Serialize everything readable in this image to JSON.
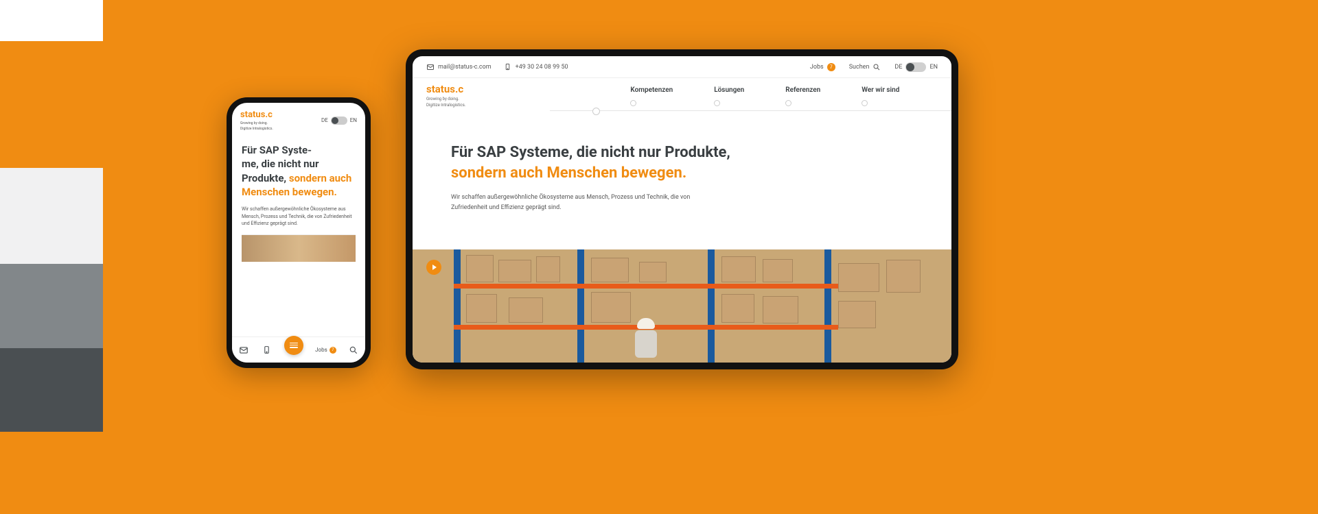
{
  "brand": {
    "name": "status.c",
    "tagline1": "Growing by doing.",
    "tagline2": "Digitize Intralogistics."
  },
  "contact": {
    "email": "mail@status-c.com",
    "phone": "+49 30 24 08 99 50"
  },
  "nav": {
    "items": [
      "Kompetenzen",
      "Lösungen",
      "Referenzen",
      "Wer wir sind"
    ]
  },
  "topbar": {
    "jobs_label": "Jobs",
    "jobs_count": "7",
    "search_label": "Suchen",
    "lang_de": "DE",
    "lang_en": "EN"
  },
  "hero": {
    "headline_dark": "Für SAP Systeme, die nicht nur Produkte, ",
    "headline_orange": "sondern auch Menschen bewegen.",
    "lead_desktop": "Wir schaffen außergewöhnliche Ökosysteme aus Mensch, Prozess und Technik, die von Zufriedenheit und Effizienz geprägt sind.",
    "lead_mobile": "Wir schaffen außergewöhnliche Ökosysteme aus Mensch, Prozess und Technik, die von Zufriedenheit und Effizienz geprägt sind.",
    "mobile_headline_dark": "Für SAP Syste-\nme, die nicht nur Produkte, ",
    "mobile_headline_orange": "sondern auch Menschen bewegen."
  },
  "mobile_bottom": {
    "jobs_label": "Jobs",
    "jobs_count": "7"
  },
  "colors": {
    "accent": "#f08c12",
    "dark": "#3a3f42"
  }
}
